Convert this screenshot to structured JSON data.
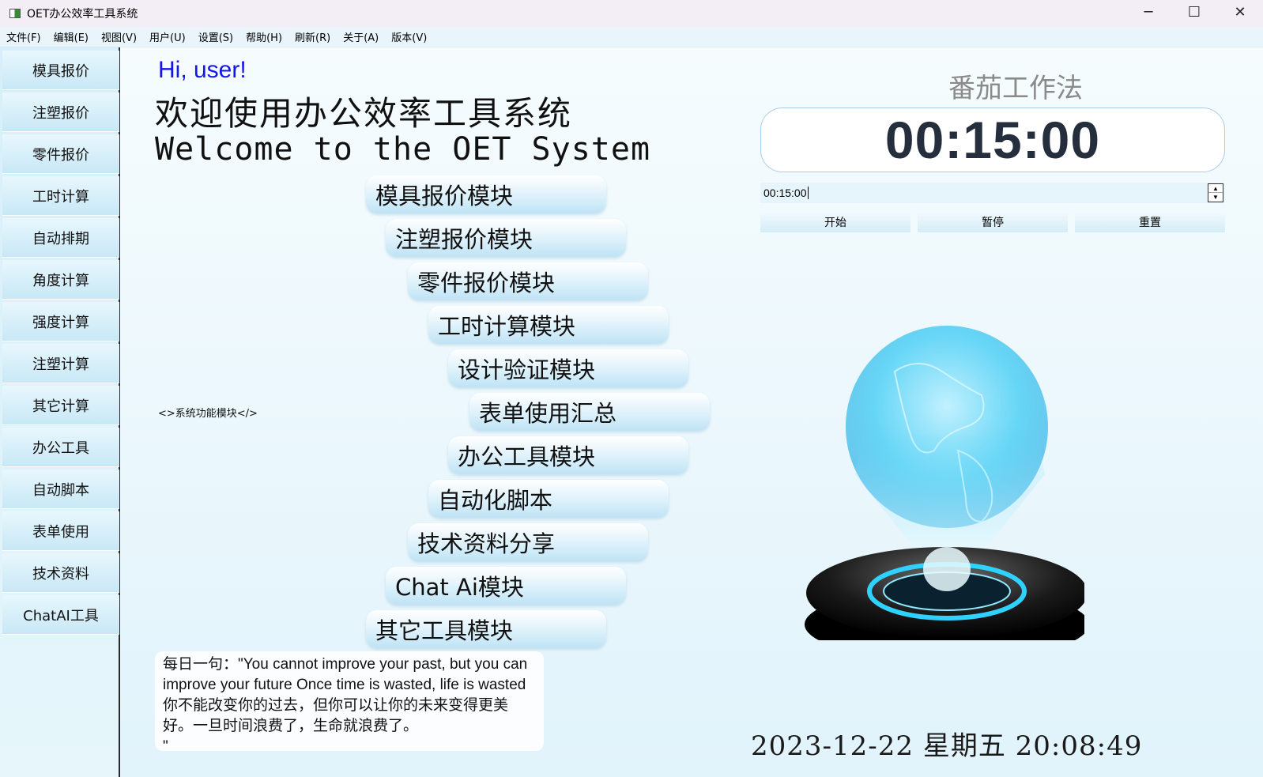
{
  "window": {
    "title": "OET办公效率工具系统",
    "controls": [
      "─",
      "☐",
      "✕"
    ]
  },
  "menu": [
    "文件(F)",
    "编辑(E)",
    "视图(V)",
    "用户(U)",
    "设置(S)",
    "帮助(H)",
    "刷新(R)",
    "关于(A)",
    "版本(V)"
  ],
  "sidebar": [
    "模具报价",
    "注塑报价",
    "零件报价",
    "工时计算",
    "自动排期",
    "角度计算",
    "强度计算",
    "注塑计算",
    "其它计算",
    "办公工具",
    "自动脚本",
    "表单使用",
    "技术资料",
    "ChatAI工具"
  ],
  "main": {
    "greeting": "Hi, user!",
    "welcome_cn": "欢迎使用办公效率工具系统",
    "welcome_en": "Welcome to the OET System",
    "modules_label": "<>系统功能模块</>",
    "modules": [
      "模具报价模块",
      "注塑报价模块",
      "零件报价模块",
      "工时计算模块",
      "设计验证模块",
      "表单使用汇总",
      "办公工具模块",
      "自动化脚本",
      "技术资料分享",
      "Chat Ai模块",
      "其它工具模块"
    ],
    "quote": "每日一句：\"You cannot improve your past, but you can improve your future Once time is wasted, life is wasted你不能改变你的过去，但你可以让你的未来变得更美好。一旦时间浪费了，生命就浪费了。\n\""
  },
  "pomodoro": {
    "title": "番茄工作法",
    "display": "00:15:00",
    "edit_value": "00:15:00",
    "buttons": [
      "开始",
      "暂停",
      "重置"
    ]
  },
  "datetime": "2023-12-22 星期五 20:08:49",
  "colors": {
    "greeting": "#1515e6",
    "globe": "#3fc8f0",
    "timer": "#242e3c"
  }
}
